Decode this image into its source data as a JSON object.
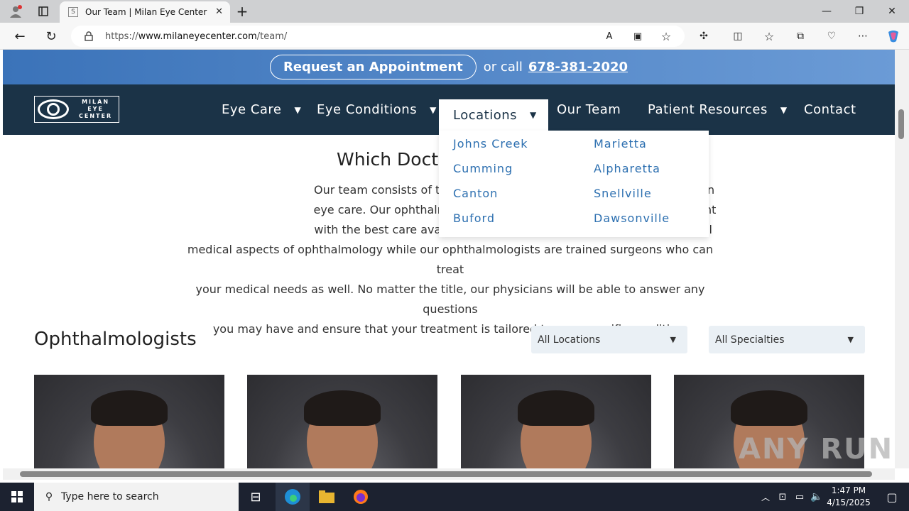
{
  "browser": {
    "tab_title": "Our Team | Milan Eye Center",
    "url_prefix": "https://",
    "url_host": "www.milaneyecenter.com",
    "url_path": "/team/",
    "new_tab_icon": "+"
  },
  "banner": {
    "request_label": "Request an Appointment",
    "or_call": "or call",
    "phone": "678-381-2020"
  },
  "logo": {
    "line1": "MILAN",
    "line2": "EYE",
    "line3": "CENTER"
  },
  "nav": {
    "items": [
      "Eye Care",
      "Eye Conditions",
      "Locations",
      "Our Team",
      "Patient Resources",
      "Contact"
    ]
  },
  "locations_dropdown": {
    "left_column": [
      "Johns Creek",
      "Cumming",
      "Canton",
      "Buford"
    ],
    "right_column": [
      "Marietta",
      "Alpharetta",
      "Snellville",
      "Dawsonville"
    ]
  },
  "content": {
    "heading": "Which Doctor",
    "intro_lines": [
      "Our team consists of twenty ophthalmologists o",
      "eye care. Our ophthalmologists and optometrist",
      "with the best care available. Our optometrists a",
      "medical aspects of ophthalmology while our ophthalmologists are trained surgeons who can treat",
      "your medical needs as well. No matter the title, our physicians will be able to answer any questions",
      "you may have and ensure that your treatment is tailored to your specific condition."
    ],
    "intro_right_fragments": [
      "n",
      "nt",
      "ll"
    ],
    "section_title": "Ophthalmologists",
    "location_filter": "All Locations",
    "specialty_filter": "All Specialties"
  },
  "taskbar": {
    "search_placeholder": "Type here to search",
    "time": "1:47 PM",
    "date": "4/15/2025"
  },
  "watermark": "ANY RUN"
}
